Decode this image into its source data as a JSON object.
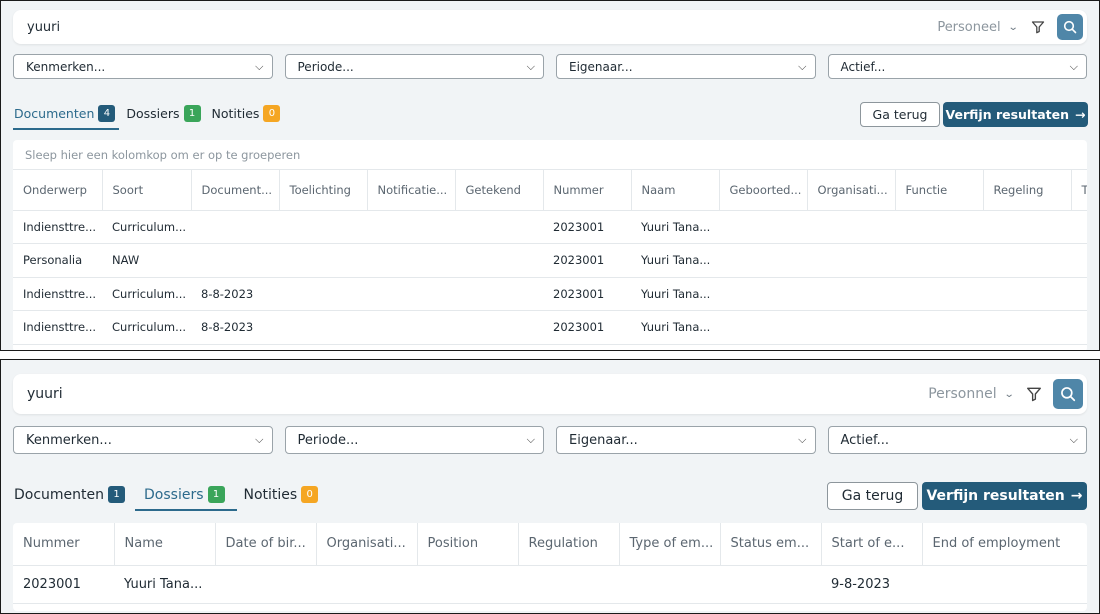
{
  "top": {
    "search": {
      "value": "yuuri",
      "scope": "Personeel"
    },
    "filters": [
      "Kenmerken...",
      "Periode...",
      "Eigenaar...",
      "Actief..."
    ],
    "tabs": [
      {
        "label": "Documenten",
        "count": "4",
        "color": "#245b7a"
      },
      {
        "label": "Dossiers",
        "count": "1",
        "color": "#3aa55a"
      },
      {
        "label": "Notities",
        "count": "0",
        "color": "#f5a623"
      }
    ],
    "buttons": {
      "back": "Ga terug",
      "refine": "Verfijn resultaten"
    },
    "group_hint": "Sleep hier een kolomkop om er op te groeperen",
    "columns": [
      "Onderwerp",
      "Soort",
      "Document...",
      "Toelichting",
      "Notificatie...",
      "Getekend",
      "Nummer",
      "Naam",
      "Geboorted...",
      "Organisati...",
      "Functie",
      "Regeling",
      "T"
    ],
    "rows": [
      [
        "Indiensttre...",
        "Curriculum...",
        "",
        "",
        "",
        "",
        "2023001",
        "Yuuri Tana...",
        "",
        "",
        "",
        "",
        ""
      ],
      [
        "Personalia",
        "NAW",
        "",
        "",
        "",
        "",
        "2023001",
        "Yuuri Tana...",
        "",
        "",
        "",
        "",
        ""
      ],
      [
        "Indiensttre...",
        "Curriculum...",
        "8-8-2023",
        "",
        "",
        "",
        "2023001",
        "Yuuri Tana...",
        "",
        "",
        "",
        "",
        ""
      ],
      [
        "Indiensttre...",
        "Curriculum...",
        "8-8-2023",
        "",
        "",
        "",
        "2023001",
        "Yuuri Tana...",
        "",
        "",
        "",
        "",
        ""
      ]
    ]
  },
  "bottom": {
    "search": {
      "value": "yuuri",
      "scope": "Personnel"
    },
    "filters": [
      "Kenmerken...",
      "Periode...",
      "Eigenaar...",
      "Actief..."
    ],
    "tabs": [
      {
        "label": "Documenten",
        "count": "1",
        "color": "#245b7a"
      },
      {
        "label": "Dossiers",
        "count": "1",
        "color": "#3aa55a"
      },
      {
        "label": "Notities",
        "count": "0",
        "color": "#f5a623"
      }
    ],
    "buttons": {
      "back": "Ga terug",
      "refine": "Verfijn resultaten"
    },
    "columns": [
      "Nummer",
      "Name",
      "Date of bir...",
      "Organisati...",
      "Position",
      "Regulation",
      "Type of em...",
      "Status em...",
      "Start of e...",
      "End of employment"
    ],
    "rows": [
      [
        "2023001",
        "Yuuri Tana...",
        "",
        "",
        "",
        "",
        "",
        "",
        "9-8-2023",
        ""
      ]
    ]
  },
  "icons": {
    "filter": "funnel-icon",
    "search": "search-icon",
    "scope_chevron": "chevron-down-icon",
    "select_chevron": "chevron-down-icon",
    "arrow": "arrow-right-icon"
  }
}
